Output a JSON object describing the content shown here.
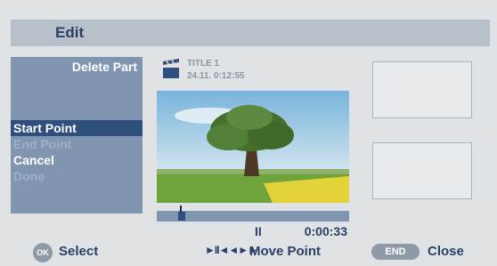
{
  "window": {
    "title": "Edit"
  },
  "menu": {
    "heading": "Delete Part",
    "items": [
      {
        "label": "Start Point",
        "state": "selected"
      },
      {
        "label": "End Point",
        "state": "disabled"
      },
      {
        "label": "Cancel",
        "state": "enabled"
      },
      {
        "label": "Done",
        "state": "disabled"
      }
    ]
  },
  "title_info": {
    "title": "TITLE 1",
    "datetime": "24.11.  0:12:55"
  },
  "playback": {
    "state_symbol": "II",
    "time": "0:00:33",
    "position_fraction": 0.15
  },
  "footer": {
    "ok_badge": "OK",
    "select_label": "Select",
    "move_icons": "►II◄◄►►",
    "move_label": "Move Point",
    "end_badge": "END",
    "close_label": "Close"
  },
  "colors": {
    "menu_bg": "#7f95b0",
    "selected_bg": "#2e4e7e",
    "title_bar": "#b7c0c8",
    "text_dark": "#2b3f66"
  }
}
